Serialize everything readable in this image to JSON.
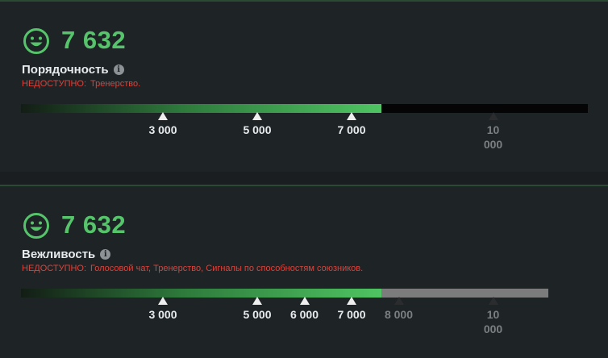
{
  "panels": [
    {
      "score": "7 632",
      "title": "Порядочность",
      "warning_label": "НЕДОСТУПНО:",
      "warning_text": "Тренерство.",
      "track_max": 10000,
      "track_style": "black",
      "fill_value": 7632,
      "ticks": [
        {
          "value": 3000,
          "label": "3 000",
          "style": "white"
        },
        {
          "value": 5000,
          "label": "5 000",
          "style": "white"
        },
        {
          "value": 7000,
          "label": "7 000",
          "style": "white"
        },
        {
          "value": 10000,
          "label": "10\n000",
          "style": "dim"
        }
      ]
    },
    {
      "score": "7 632",
      "title": "Вежливость",
      "warning_label": "НЕДОСТУПНО:",
      "warning_text": "Голосовой чат, Тренерство, Сигналы по способностям союзников.",
      "track_max": 10000,
      "track_style": "grey",
      "fill_value": 7632,
      "ticks": [
        {
          "value": 3000,
          "label": "3 000",
          "style": "white"
        },
        {
          "value": 5000,
          "label": "5 000",
          "style": "white"
        },
        {
          "value": 6000,
          "label": "6 000",
          "style": "white"
        },
        {
          "value": 7000,
          "label": "7 000",
          "style": "white"
        },
        {
          "value": 8000,
          "label": "8 000",
          "style": "dim"
        },
        {
          "value": 10000,
          "label": "10\n000",
          "style": "dim"
        }
      ]
    }
  ],
  "colors": {
    "accent_green": "#55c46a",
    "warning_red": "#d9443c"
  },
  "icons": {
    "face": "smiley-face-icon",
    "info": "info-icon"
  }
}
